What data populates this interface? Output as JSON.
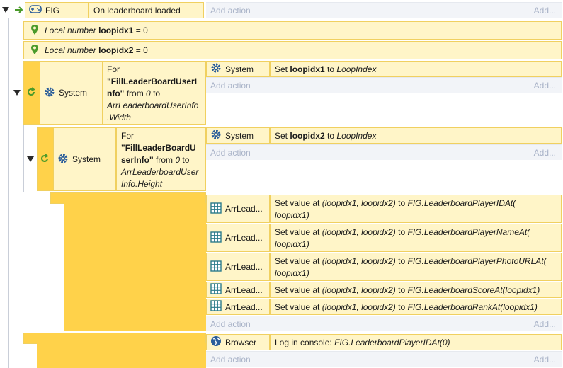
{
  "event1": {
    "object": "FIG",
    "condition": "On leaderboard loaded",
    "add_action": "Add action",
    "add_short": "Add...",
    "locals": [
      {
        "prefix": "Local number",
        "name": "loopidx1",
        "value": "= 0"
      },
      {
        "prefix": "Local number",
        "name": "loopidx2",
        "value": "= 0"
      }
    ]
  },
  "loop1": {
    "object": "System",
    "for_label": "For",
    "for_name_lines": [
      "\"FillLeaderBoardUserI",
      "nfo\""
    ],
    "from": "from",
    "from_val": "0",
    "to": "to",
    "to_lines": [
      "ArrLeaderboardUserInfo",
      ".Width"
    ],
    "action_object": "System",
    "action_pre": "Set",
    "action_var": "loopidx1",
    "action_mid": "to",
    "action_val": "LoopIndex",
    "add_action": "Add action",
    "add_short": "Add..."
  },
  "loop2": {
    "object": "System",
    "for_label": "For",
    "for_name_lines": [
      "\"FillLeaderBoardU",
      "serInfo\""
    ],
    "from": "from",
    "from_val": "0",
    "to": "to",
    "to_lines": [
      "ArrLeaderboardUser",
      "Info.Height"
    ],
    "action_object": "System",
    "action_pre": "Set",
    "action_var": "loopidx2",
    "action_mid": "to",
    "action_val": "LoopIndex",
    "add_action": "Add action",
    "add_short": "Add..."
  },
  "inner": {
    "actions": [
      {
        "object": "ArrLead...",
        "pre": "Set value at",
        "args": "(loopidx1, loopidx2)",
        "to": "to",
        "expr": "FIG.LeaderboardPlayerIDAt(",
        "expr2": "loopidx1)"
      },
      {
        "object": "ArrLead...",
        "pre": "Set value at",
        "args": "(loopidx1, loopidx2)",
        "to": "to",
        "expr": "FIG.LeaderboardPlayerNameAt(",
        "expr2": "loopidx1)"
      },
      {
        "object": "ArrLead...",
        "pre": "Set value at",
        "args": "(loopidx1, loopidx2)",
        "to": "to",
        "expr": "FIG.LeaderboardPlayerPhotoURLAt(",
        "expr2": "loopidx1)"
      },
      {
        "object": "ArrLead...",
        "pre": "Set value at",
        "args": "(loopidx1, loopidx2)",
        "to": "to",
        "expr": "FIG.LeaderboardScoreAt(loopidx1)",
        "expr2": ""
      },
      {
        "object": "ArrLead...",
        "pre": "Set value at",
        "args": "(loopidx1, loopidx2)",
        "to": "to",
        "expr": "FIG.LeaderboardRankAt(loopidx1)",
        "expr2": ""
      }
    ],
    "add_action": "Add action",
    "add_short": "Add..."
  },
  "last": {
    "object": "Browser",
    "pre": "Log in console:",
    "expr": "FIG.LeaderboardPlayerIDAt(0)",
    "add_action": "Add action",
    "add_short": "Add..."
  },
  "colors": {
    "accent": "#ffd24a",
    "cell_bg": "#fff5c8",
    "border": "#f0d060",
    "add_text": "#a9b3c8",
    "icon_blue": "#2a5d9a"
  }
}
